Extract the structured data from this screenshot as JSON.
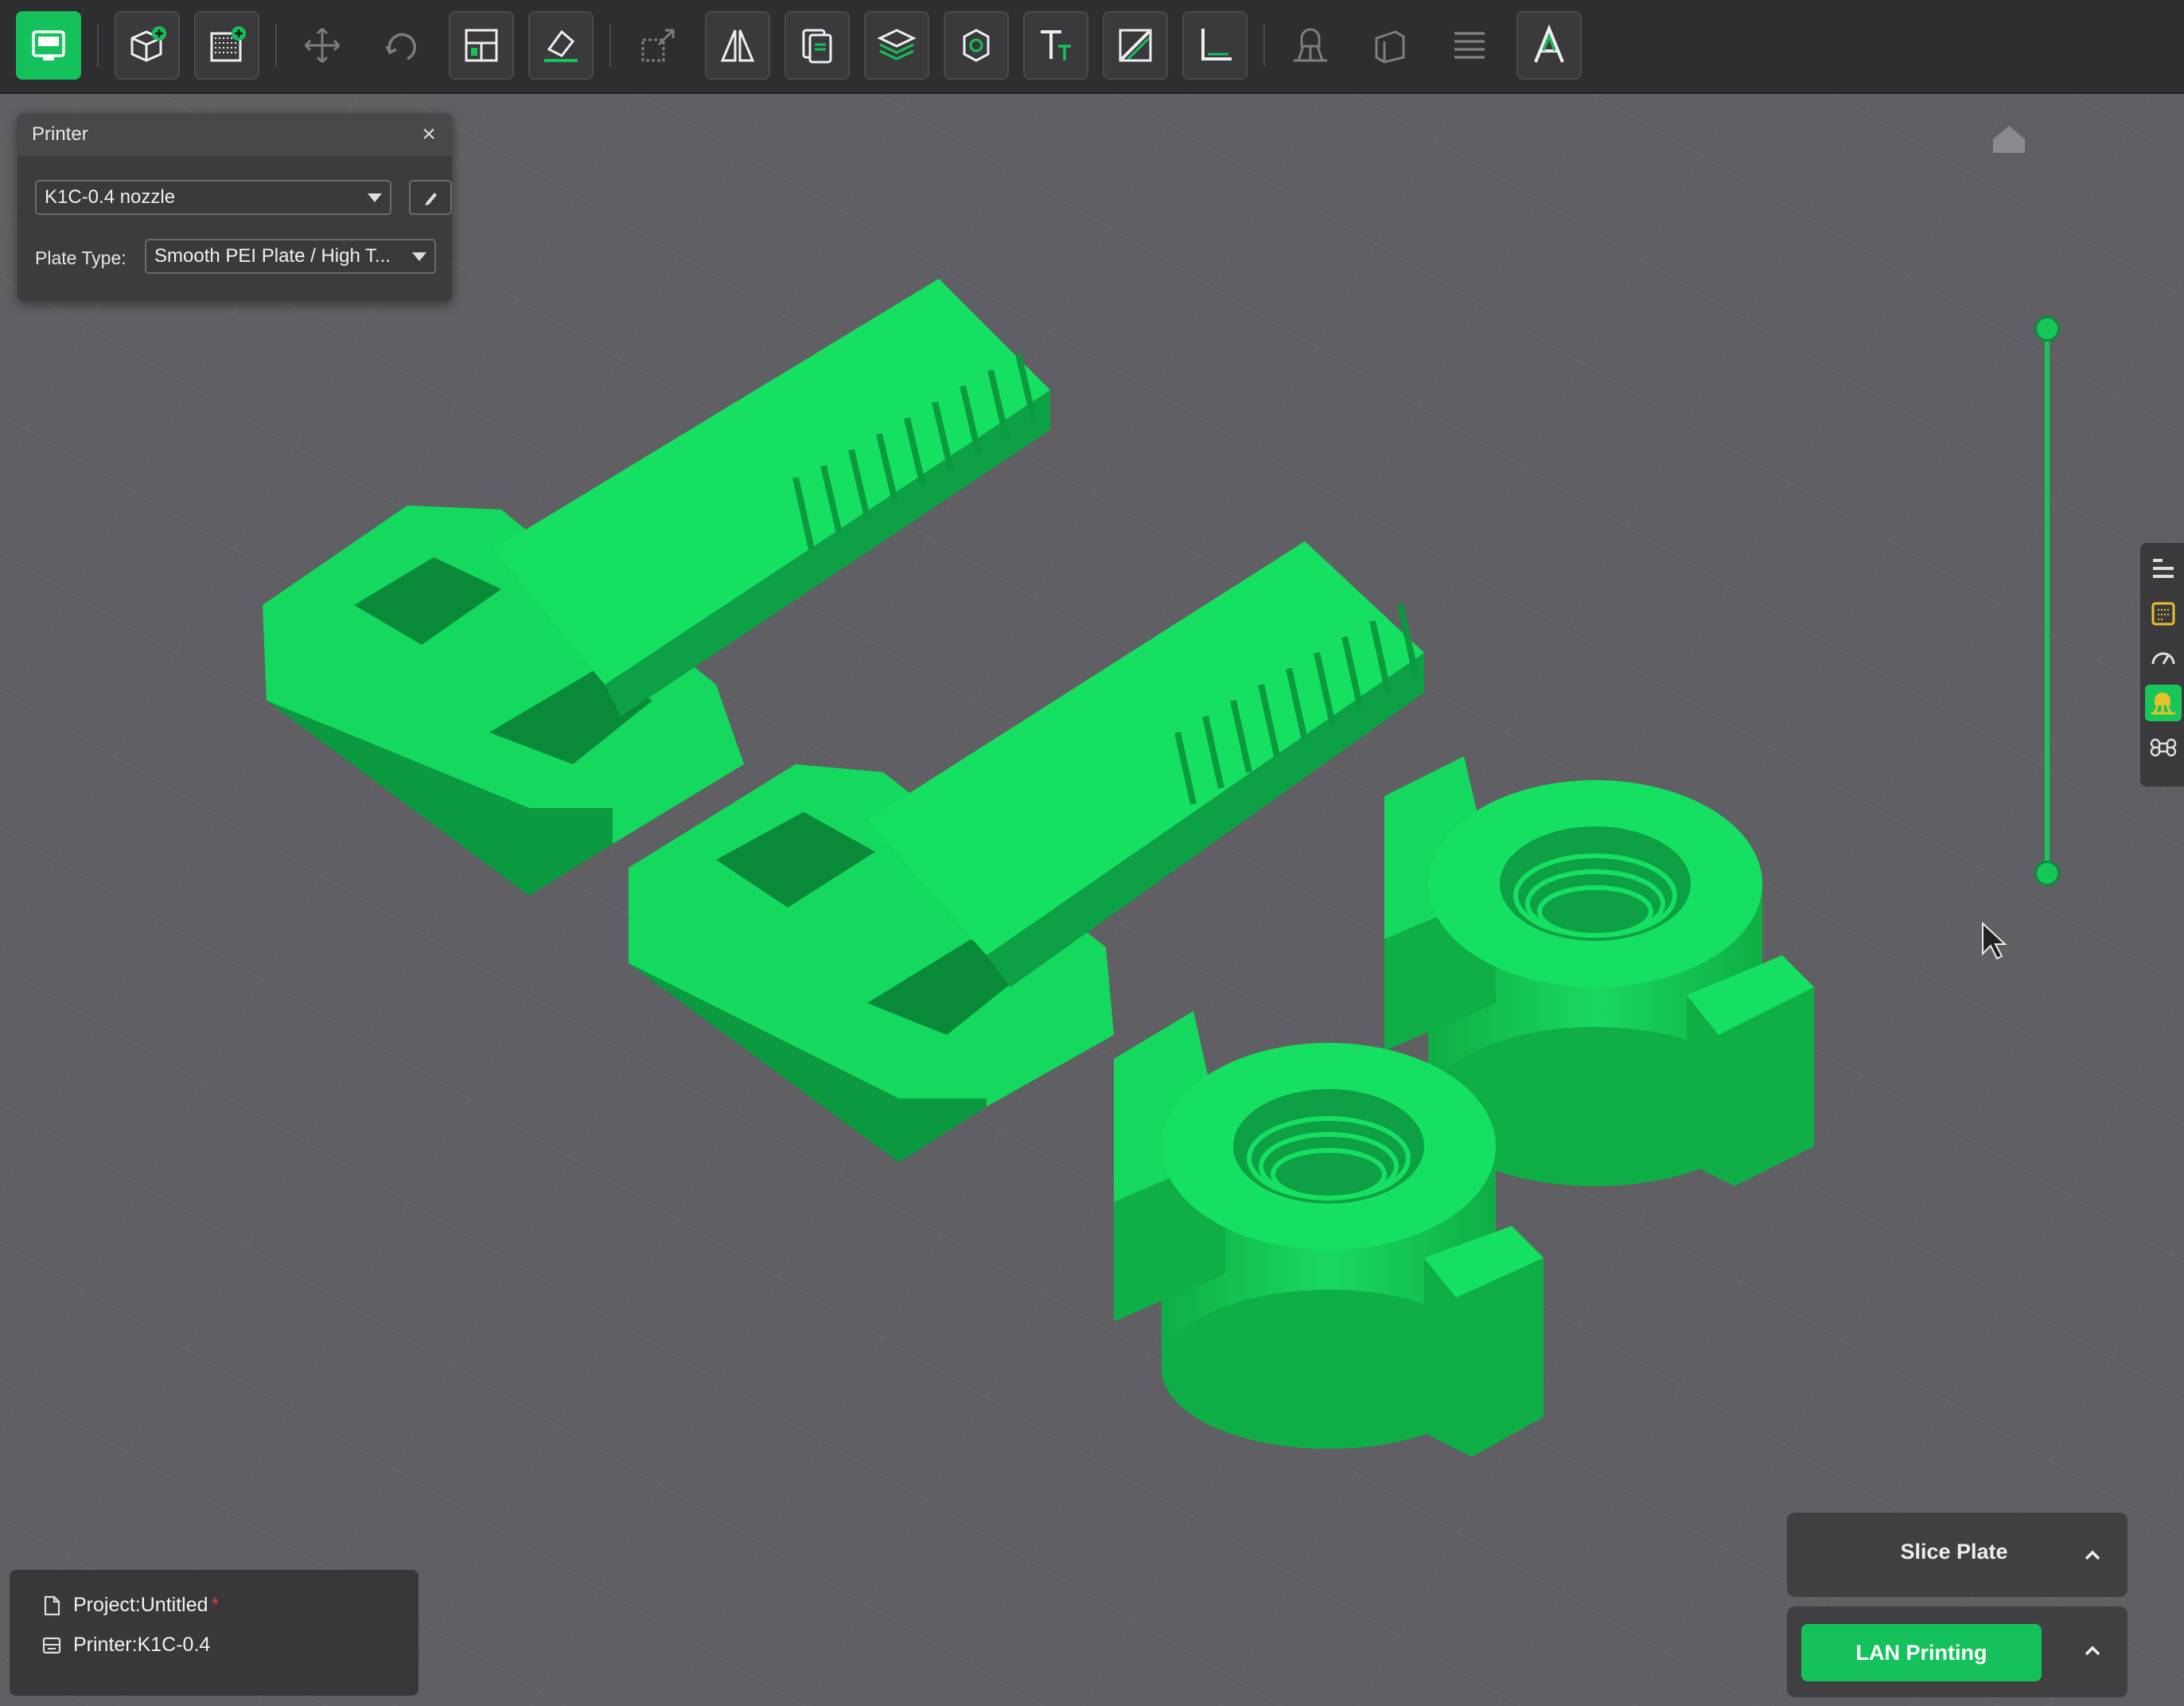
{
  "toolbar": {
    "buttons": [
      {
        "name": "prepare-view-button",
        "icon": "monitor-icon"
      },
      {
        "name": "add-object-button",
        "icon": "add-cube-icon"
      },
      {
        "name": "add-plate-button",
        "icon": "add-plate-icon"
      },
      {
        "name": "move-button",
        "icon": "move-icon"
      },
      {
        "name": "rotate-button",
        "icon": "rotate-icon"
      },
      {
        "name": "arrange-button",
        "icon": "arrange-icon"
      },
      {
        "name": "lay-on-face-button",
        "icon": "lay-on-face-icon"
      },
      {
        "name": "scale-button",
        "icon": "scale-icon"
      },
      {
        "name": "mirror-button",
        "icon": "mirror-icon"
      },
      {
        "name": "split-button",
        "icon": "split-icon"
      },
      {
        "name": "layers-button",
        "icon": "layers-icon"
      },
      {
        "name": "cut-button",
        "icon": "cut-icon"
      },
      {
        "name": "text-button",
        "icon": "text-icon"
      },
      {
        "name": "paint-button",
        "icon": "paint-icon"
      },
      {
        "name": "measure-button",
        "icon": "measure-icon"
      },
      {
        "name": "support-painting-button",
        "icon": "support-icon"
      },
      {
        "name": "seam-painting-button",
        "icon": "seam-icon"
      },
      {
        "name": "variable-layer-button",
        "icon": "variable-layer-icon"
      },
      {
        "name": "assembly-button",
        "icon": "assembly-icon"
      }
    ]
  },
  "printer_panel": {
    "title": "Printer",
    "printer_value": "K1C-0.4 nozzle",
    "plate_type_label": "Plate Type:",
    "plate_type_value": "Smooth PEI Plate / High T..."
  },
  "status": {
    "project_label": "Project:Untitled",
    "modified_marker": "*",
    "printer_label": "Printer:K1C-0.4"
  },
  "actions": {
    "slice_label": "Slice Plate",
    "print_label": "LAN Printing"
  },
  "colors": {
    "accent": "#14c15a",
    "model": "#14d95e",
    "background": "#605f63",
    "toolbar": "#2e2e30"
  }
}
